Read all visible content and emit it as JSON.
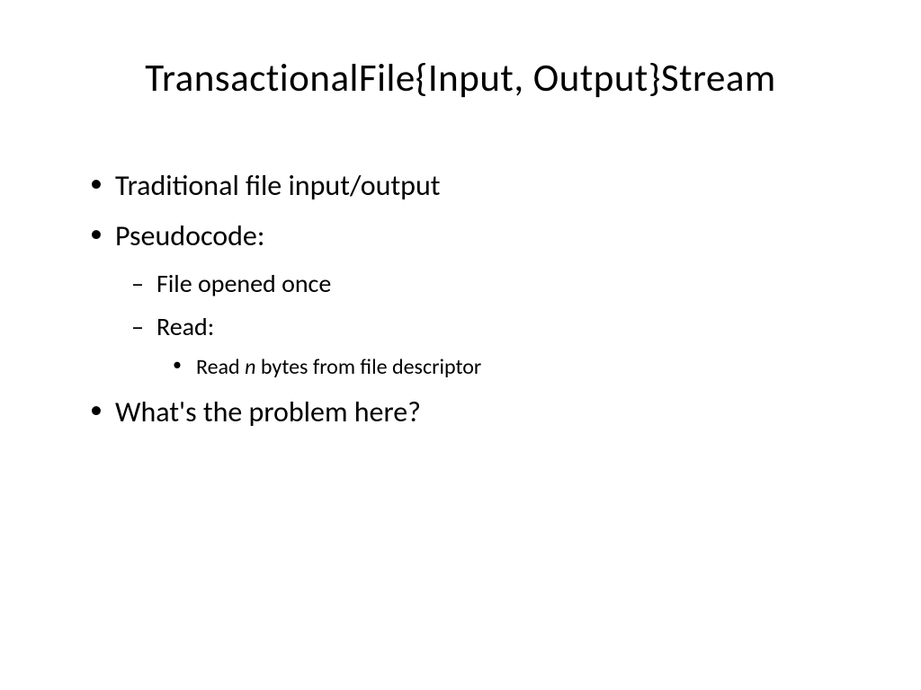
{
  "slide": {
    "title": "TransactionalFile{Input, Output}Stream",
    "bullets": {
      "b1": "Traditional file input/output",
      "b2": "Pseudocode:",
      "b2_1": "File opened once",
      "b2_2": "Read:",
      "b2_2_1_pre": "Read ",
      "b2_2_1_em": "n",
      "b2_2_1_post": " bytes from file descriptor",
      "b3": "What's the problem here?"
    }
  }
}
